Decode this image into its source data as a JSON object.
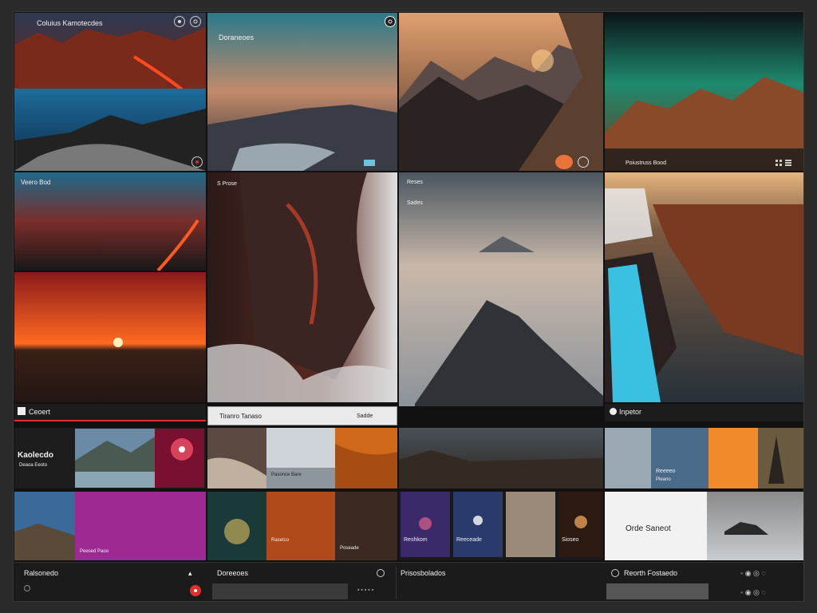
{
  "row1": {
    "tile1_title": "Coluius Kamotecdes",
    "tile2_title": "Doraneoes"
  },
  "row2": {
    "tile1_title": "Veero Bod",
    "tile2_title": "S Prose",
    "tile3_title": "Reses",
    "tile3_subtitle": "Sades"
  },
  "row1_caption": "Poiustruss Bood",
  "labels": {
    "section_a": "Ceoert",
    "search_field": "Tiranro Tanaso",
    "search_btn": "Sadde",
    "section_b": "Inpetor",
    "lower_title_a": "Kaolecdo",
    "lower_title_a_sub": "Deaoa Eeoto",
    "lower_pink_caption": "Peesed Paoo",
    "lower_mid_caption": "Pasonce Bare",
    "lower_right_caption": "Reeeeo",
    "lower_right_sub": "Pleano",
    "row4_caption_a": "Rasetco",
    "row4_caption_b": "Poseade",
    "row4_caption_c": "Reshkom",
    "row4_caption_d": "Reeceade",
    "row4_caption_e": "Sioseo",
    "card_text": "Orde Saneot"
  },
  "footer": {
    "col1": "Ralsonedo",
    "col2": "Doreeoes",
    "col3": "Prisosbolados",
    "col4": "Reorth Fostaedo"
  },
  "colors": {
    "accent_red": "#e0302e",
    "accent_orange": "#e8743a",
    "bg": "#111111"
  }
}
